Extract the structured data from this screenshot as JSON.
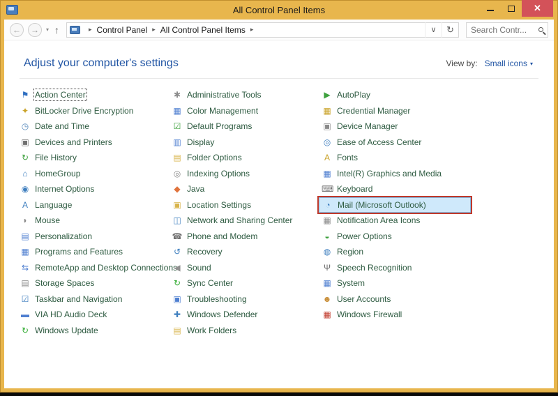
{
  "window": {
    "title": "All Control Panel Items"
  },
  "titlebar": {
    "close_glyph": "✕"
  },
  "navbar": {
    "back_glyph": "←",
    "forward_glyph": "→",
    "history_caret": "▾",
    "up_glyph": "↑",
    "breadcrumb": {
      "crumbs": [
        "Control Panel",
        "All Control Panel Items"
      ],
      "separator": "▸"
    },
    "address_caret": "∨",
    "refresh_glyph": "↻",
    "search": {
      "placeholder": "Search Contr..."
    }
  },
  "header": {
    "title": "Adjust your computer's settings",
    "view_by_label": "View by:",
    "view_by_value": "Small icons",
    "view_by_caret": "▾"
  },
  "items": {
    "columns": [
      [
        {
          "label": "Action Center",
          "icon": "flag",
          "glyph": "⚑",
          "color": "#2f6fc1",
          "focused": true
        },
        {
          "label": "BitLocker Drive Encryption",
          "icon": "bitlocker-lock",
          "glyph": "✦",
          "color": "#c9a227"
        },
        {
          "label": "Date and Time",
          "icon": "clock-calendar",
          "glyph": "◷",
          "color": "#5b8dbe"
        },
        {
          "label": "Devices and Printers",
          "icon": "printer",
          "glyph": "▣",
          "color": "#707070"
        },
        {
          "label": "File History",
          "icon": "file-history",
          "glyph": "↻",
          "color": "#3fa13f"
        },
        {
          "label": "HomeGroup",
          "icon": "homegroup",
          "glyph": "⌂",
          "color": "#3f7fbf"
        },
        {
          "label": "Internet Options",
          "icon": "globe",
          "glyph": "◉",
          "color": "#3f7fbf"
        },
        {
          "label": "Language",
          "icon": "language",
          "glyph": "A",
          "color": "#3f7fbf"
        },
        {
          "label": "Mouse",
          "icon": "mouse",
          "glyph": "◗",
          "color": "#8a8a8a"
        },
        {
          "label": "Personalization",
          "icon": "personalization-monitor",
          "glyph": "▤",
          "color": "#4f7fd0"
        },
        {
          "label": "Programs and Features",
          "icon": "programs",
          "glyph": "▦",
          "color": "#4f7fd0"
        },
        {
          "label": "RemoteApp and Desktop Connections",
          "icon": "remote-connections",
          "glyph": "⇆",
          "color": "#4f7fd0"
        },
        {
          "label": "Storage Spaces",
          "icon": "storage-drive",
          "glyph": "▤",
          "color": "#8a8a8a"
        },
        {
          "label": "Taskbar and Navigation",
          "icon": "taskbar-check",
          "glyph": "☑",
          "color": "#3f7fbf"
        },
        {
          "label": "VIA HD Audio Deck",
          "icon": "audio-deck",
          "glyph": "▬",
          "color": "#4f7fd0"
        },
        {
          "label": "Windows Update",
          "icon": "windows-update",
          "glyph": "↻",
          "color": "#2faa2f"
        }
      ],
      [
        {
          "label": "Administrative Tools",
          "icon": "admin-tools",
          "glyph": "✱",
          "color": "#8a8a8a"
        },
        {
          "label": "Color Management",
          "icon": "color-monitor",
          "glyph": "▦",
          "color": "#4f7fd0"
        },
        {
          "label": "Default Programs",
          "icon": "default-programs-check",
          "glyph": "☑",
          "color": "#3fa13f"
        },
        {
          "label": "Display",
          "icon": "display-monitor",
          "glyph": "▥",
          "color": "#4f7fd0"
        },
        {
          "label": "Folder Options",
          "icon": "folder",
          "glyph": "▤",
          "color": "#d8b44a"
        },
        {
          "label": "Indexing Options",
          "icon": "indexing-magnifier",
          "glyph": "◎",
          "color": "#8a8a8a"
        },
        {
          "label": "Java",
          "icon": "java-cup",
          "glyph": "◆",
          "color": "#e0733d"
        },
        {
          "label": "Location Settings",
          "icon": "location",
          "glyph": "▣",
          "color": "#d8b44a"
        },
        {
          "label": "Network and Sharing Center",
          "icon": "network",
          "glyph": "◫",
          "color": "#3f7fbf"
        },
        {
          "label": "Phone and Modem",
          "icon": "phone",
          "glyph": "☎",
          "color": "#707070"
        },
        {
          "label": "Recovery",
          "icon": "recovery-arrow",
          "glyph": "↺",
          "color": "#3f7fbf"
        },
        {
          "label": "Sound",
          "icon": "speaker",
          "glyph": "◀",
          "color": "#909090"
        },
        {
          "label": "Sync Center",
          "icon": "sync-arrows",
          "glyph": "↻",
          "color": "#2faa2f"
        },
        {
          "label": "Troubleshooting",
          "icon": "troubleshooting",
          "glyph": "▣",
          "color": "#4f7fd0"
        },
        {
          "label": "Windows Defender",
          "icon": "defender-shield",
          "glyph": "✚",
          "color": "#3f7fbf"
        },
        {
          "label": "Work Folders",
          "icon": "work-folders",
          "glyph": "▤",
          "color": "#d8b44a"
        }
      ],
      [
        {
          "label": "AutoPlay",
          "icon": "autoplay",
          "glyph": "▶",
          "color": "#3fa13f"
        },
        {
          "label": "Credential Manager",
          "icon": "credential-vault",
          "glyph": "▦",
          "color": "#c9a227"
        },
        {
          "label": "Device Manager",
          "icon": "device-manager",
          "glyph": "▣",
          "color": "#8a8a8a"
        },
        {
          "label": "Ease of Access Center",
          "icon": "ease-of-access",
          "glyph": "◎",
          "color": "#3f7fbf"
        },
        {
          "label": "Fonts",
          "icon": "fonts-letter",
          "glyph": "A",
          "color": "#c9a227"
        },
        {
          "label": "Intel(R) Graphics and Media",
          "icon": "intel-graphics",
          "glyph": "▦",
          "color": "#4f7fd0"
        },
        {
          "label": "Keyboard",
          "icon": "keyboard",
          "glyph": "⌨",
          "color": "#707070"
        },
        {
          "label": "Mail (Microsoft Outlook)",
          "icon": "mail-outlook",
          "glyph": "◔",
          "color": "#3f7fbf",
          "highlighted": true
        },
        {
          "label": "Notification Area Icons",
          "icon": "notification-monitor",
          "glyph": "▦",
          "color": "#8a8a8a"
        },
        {
          "label": "Power Options",
          "icon": "power-battery",
          "glyph": "◒",
          "color": "#3fa13f"
        },
        {
          "label": "Region",
          "icon": "region-globe",
          "glyph": "◍",
          "color": "#3f7fbf"
        },
        {
          "label": "Speech Recognition",
          "icon": "microphone",
          "glyph": "Ψ",
          "color": "#707070"
        },
        {
          "label": "System",
          "icon": "system-monitor",
          "glyph": "▦",
          "color": "#4f7fd0"
        },
        {
          "label": "User Accounts",
          "icon": "user-accounts",
          "glyph": "☻",
          "color": "#c98f3a"
        },
        {
          "label": "Windows Firewall",
          "icon": "firewall-wall",
          "glyph": "▦",
          "color": "#c0392b"
        }
      ]
    ]
  },
  "colors": {
    "titlebar_gold": "#e8b64d",
    "close_button_red": "#d35259",
    "link_blue": "#2155a4",
    "item_text_green": "#2e5b41",
    "highlight_bg": "#cfe9fb",
    "highlight_border": "#84bfe8",
    "annotation_red": "#c0392b"
  }
}
